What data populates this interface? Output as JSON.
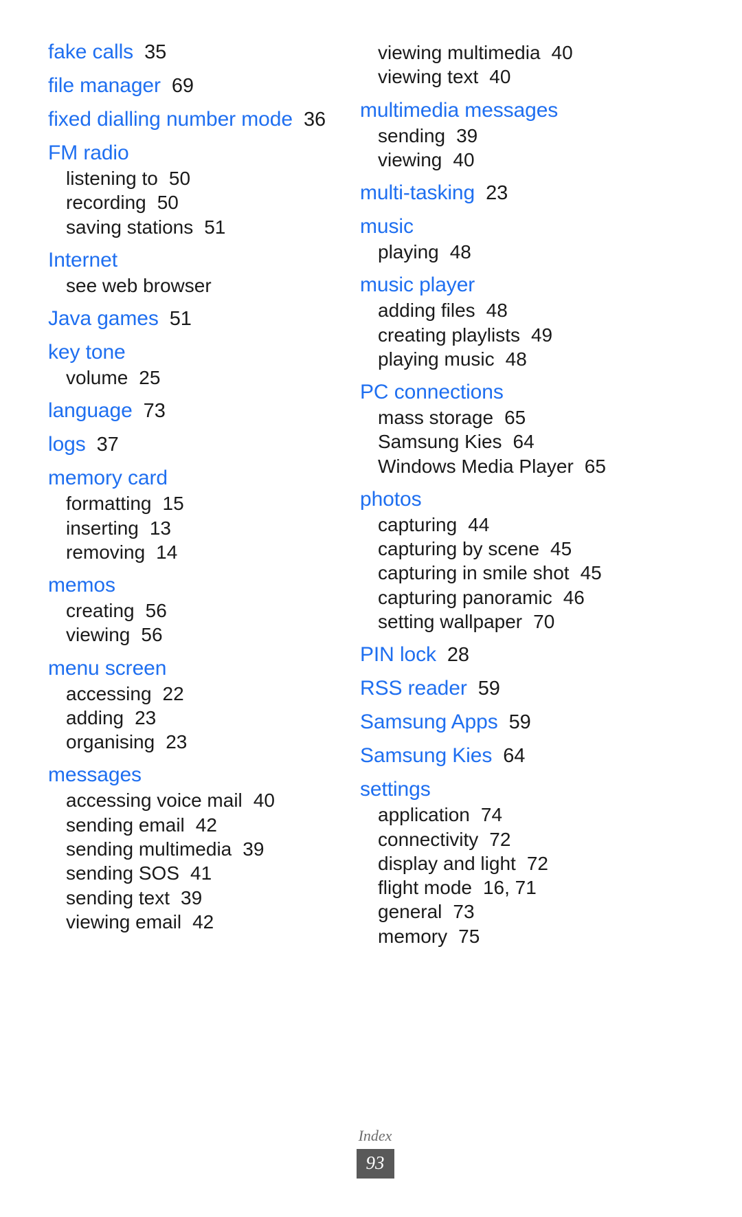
{
  "document": {
    "type": "index-page",
    "footer_label": "Index",
    "page_number": "93",
    "accent_color": "#1f6ff0",
    "text_color": "#1a1a1a",
    "footer_box_color": "#595959"
  },
  "columns": [
    {
      "id": "left",
      "entries": [
        {
          "term": "fake calls",
          "page": "35",
          "subs": []
        },
        {
          "term": "file manager",
          "page": "69",
          "subs": []
        },
        {
          "term": "fixed dialling number mode",
          "page": "36",
          "subs": []
        },
        {
          "term": "FM radio",
          "page": "",
          "subs": [
            {
              "label": "listening to",
              "page": "50"
            },
            {
              "label": "recording",
              "page": "50"
            },
            {
              "label": "saving stations",
              "page": "51"
            }
          ]
        },
        {
          "term": "Internet",
          "page": "",
          "subs": [
            {
              "label": "see web browser",
              "page": ""
            }
          ]
        },
        {
          "term": "Java games",
          "page": "51",
          "subs": []
        },
        {
          "term": "key tone",
          "page": "",
          "subs": [
            {
              "label": "volume",
              "page": "25"
            }
          ]
        },
        {
          "term": "language",
          "page": "73",
          "subs": []
        },
        {
          "term": "logs",
          "page": "37",
          "subs": []
        },
        {
          "term": "memory card",
          "page": "",
          "subs": [
            {
              "label": "formatting",
              "page": "15"
            },
            {
              "label": "inserting",
              "page": "13"
            },
            {
              "label": "removing",
              "page": "14"
            }
          ]
        },
        {
          "term": "memos",
          "page": "",
          "subs": [
            {
              "label": "creating",
              "page": "56"
            },
            {
              "label": "viewing",
              "page": "56"
            }
          ]
        },
        {
          "term": "menu screen",
          "page": "",
          "subs": [
            {
              "label": "accessing",
              "page": "22"
            },
            {
              "label": "adding",
              "page": "23"
            },
            {
              "label": "organising",
              "page": "23"
            }
          ]
        },
        {
          "term": "messages",
          "page": "",
          "subs": [
            {
              "label": "accessing voice mail",
              "page": "40"
            },
            {
              "label": "sending email",
              "page": "42"
            },
            {
              "label": "sending multimedia",
              "page": "39"
            },
            {
              "label": "sending SOS",
              "page": "41"
            },
            {
              "label": "sending text",
              "page": "39"
            },
            {
              "label": "viewing email",
              "page": "42"
            }
          ]
        }
      ]
    },
    {
      "id": "right",
      "entries": [
        {
          "term": "",
          "page": "",
          "subs": [
            {
              "label": "viewing multimedia",
              "page": "40"
            },
            {
              "label": "viewing text",
              "page": "40"
            }
          ]
        },
        {
          "term": "multimedia messages",
          "page": "",
          "subs": [
            {
              "label": "sending",
              "page": "39"
            },
            {
              "label": "viewing",
              "page": "40"
            }
          ]
        },
        {
          "term": "multi-tasking",
          "page": "23",
          "subs": []
        },
        {
          "term": "music",
          "page": "",
          "subs": [
            {
              "label": "playing",
              "page": "48"
            }
          ]
        },
        {
          "term": "music player",
          "page": "",
          "subs": [
            {
              "label": "adding files",
              "page": "48"
            },
            {
              "label": "creating playlists",
              "page": "49"
            },
            {
              "label": "playing music",
              "page": "48"
            }
          ]
        },
        {
          "term": "PC connections",
          "page": "",
          "subs": [
            {
              "label": "mass storage",
              "page": "65"
            },
            {
              "label": "Samsung Kies",
              "page": "64"
            },
            {
              "label": "Windows Media Player",
              "page": "65"
            }
          ]
        },
        {
          "term": "photos",
          "page": "",
          "subs": [
            {
              "label": "capturing",
              "page": "44"
            },
            {
              "label": "capturing by scene",
              "page": "45"
            },
            {
              "label": "capturing in smile shot",
              "page": "45"
            },
            {
              "label": "capturing panoramic",
              "page": "46"
            },
            {
              "label": "setting wallpaper",
              "page": "70"
            }
          ]
        },
        {
          "term": "PIN lock",
          "page": "28",
          "subs": []
        },
        {
          "term": "RSS reader",
          "page": "59",
          "subs": []
        },
        {
          "term": "Samsung Apps",
          "page": "59",
          "subs": []
        },
        {
          "term": "Samsung Kies",
          "page": "64",
          "subs": []
        },
        {
          "term": "settings",
          "page": "",
          "subs": [
            {
              "label": "application",
              "page": "74"
            },
            {
              "label": "connectivity",
              "page": "72"
            },
            {
              "label": "display and light",
              "page": "72"
            },
            {
              "label": "flight mode",
              "page": "16, 71"
            },
            {
              "label": "general",
              "page": "73"
            },
            {
              "label": "memory",
              "page": "75"
            }
          ]
        }
      ]
    }
  ]
}
